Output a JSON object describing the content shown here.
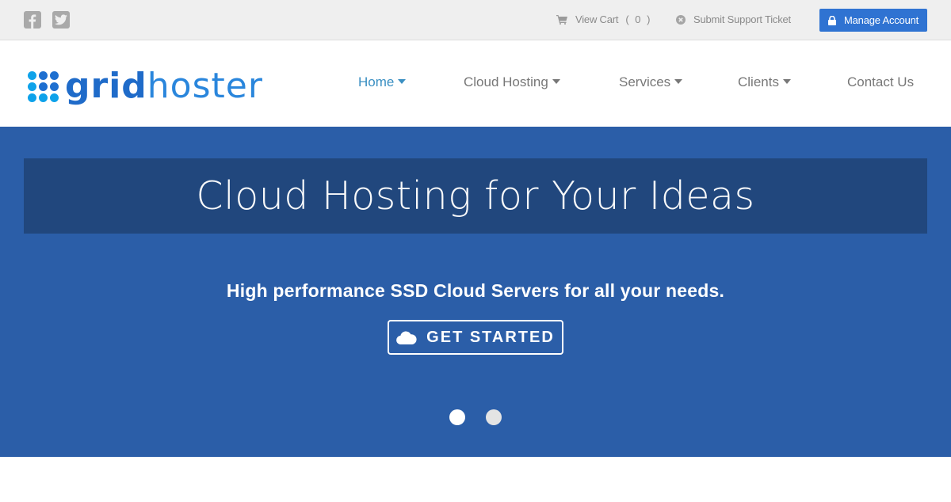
{
  "topbar": {
    "social": [
      {
        "name": "facebook",
        "icon": "facebook-icon"
      },
      {
        "name": "twitter",
        "icon": "twitter-icon"
      }
    ],
    "cart": {
      "label": "View Cart",
      "count": "( 0 )",
      "icon": "cart-icon"
    },
    "ticket": {
      "label": "Submit Support Ticket",
      "icon": "support-ticket-icon"
    },
    "manage_account": {
      "label": "Manage Account",
      "icon": "lock-icon"
    }
  },
  "header": {
    "logo": {
      "text_bold": "grid",
      "text_light": "hoster",
      "dot_colors": [
        "#0ea2ea",
        "#1e6fd0",
        "#1e6fd0",
        "#0ea2ea",
        "#1e6fd0",
        "#1e6fd0",
        "#0ea2ea",
        "#0ea2ea",
        "#0ea2ea"
      ]
    },
    "nav": [
      {
        "label": "Home",
        "has_dropdown": true,
        "active": true
      },
      {
        "label": "Cloud Hosting",
        "has_dropdown": true,
        "active": false
      },
      {
        "label": "Services",
        "has_dropdown": true,
        "active": false
      },
      {
        "label": "Clients",
        "has_dropdown": true,
        "active": false
      },
      {
        "label": "Contact Us",
        "has_dropdown": false,
        "active": false
      }
    ]
  },
  "hero": {
    "title": "Cloud Hosting for Your Ideas",
    "subtitle": "High performance SSD Cloud Servers for all your needs.",
    "cta_label": "GET STARTED",
    "cta_icon": "cloud-icon",
    "slides": {
      "count": 2,
      "active": 1
    }
  },
  "colors": {
    "accent": "#2f73d2",
    "hero_bg": "#2b5ea8",
    "hero_band": "#21477d",
    "nav_active": "#3a8fc2",
    "nav_text": "#777777",
    "topbar_bg": "#efefef"
  }
}
